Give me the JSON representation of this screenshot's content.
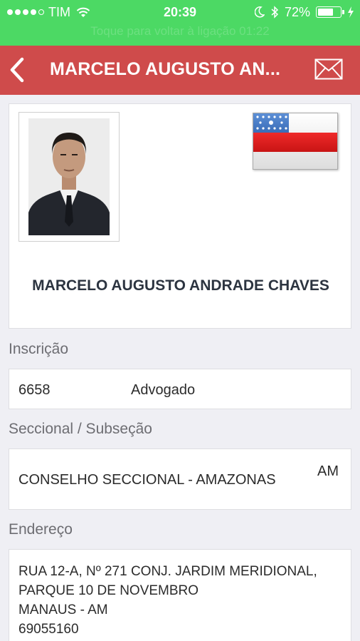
{
  "status_bar": {
    "carrier": "TIM",
    "time": "20:39",
    "battery": "72%",
    "battery_level": 0.72,
    "signal_bars": 4,
    "call_banner": "Toque para voltar à ligação  01:22"
  },
  "nav": {
    "title": "MARCELO AUGUSTO AN...",
    "back_icon": "chevron-left-icon",
    "mail_icon": "envelope-icon"
  },
  "profile": {
    "name": "MARCELO AUGUSTO ANDRADE CHAVES",
    "photo": "lawyer-photo",
    "flag": "amazonas-state-flag"
  },
  "inscricao": {
    "label": "Inscrição",
    "number": "6658",
    "type": "Advogado"
  },
  "seccional": {
    "label": "Seccional / Subseção",
    "name": "CONSELHO SECCIONAL - AMAZONAS",
    "uf": "AM"
  },
  "endereco": {
    "label": "Endereço",
    "line1": "RUA 12-A, Nº 271 CONJ. JARDIM MERIDIONAL,",
    "line2": "PARQUE 10 DE NOVEMBRO",
    "line3": "MANAUS - AM",
    "line4": "69055160"
  },
  "colors": {
    "status_green": "#4cd964",
    "nav_red": "#cf4b4b",
    "background": "#efeff4"
  }
}
